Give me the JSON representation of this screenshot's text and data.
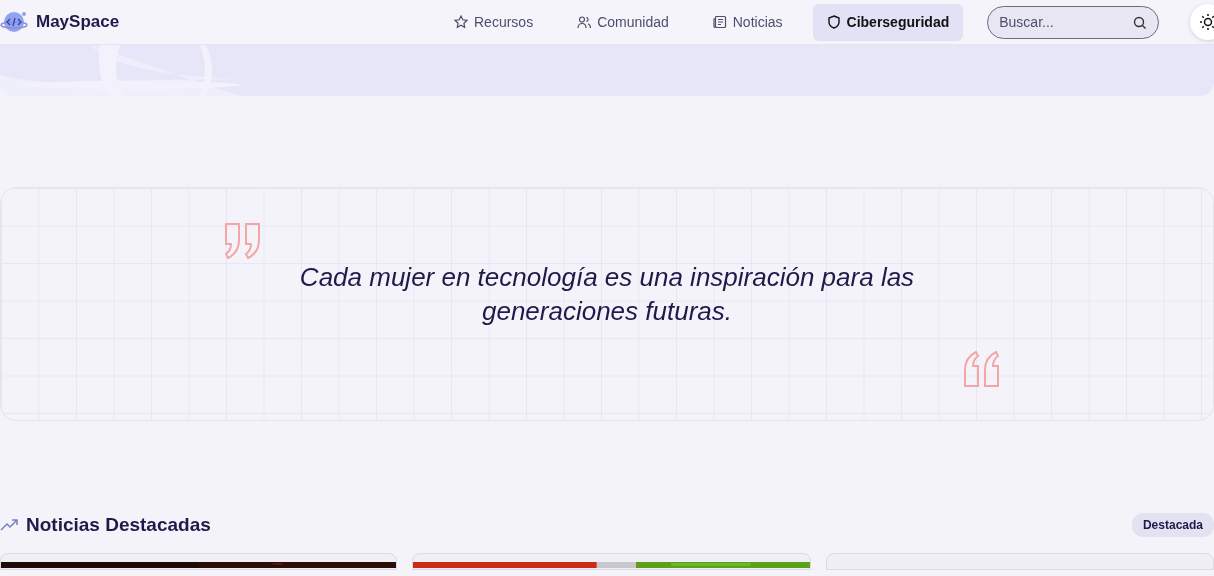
{
  "brand": {
    "name": "MaySpace"
  },
  "nav": [
    {
      "label": "Recursos",
      "selected": false
    },
    {
      "label": "Comunidad",
      "selected": false
    },
    {
      "label": "Noticias",
      "selected": false
    },
    {
      "label": "Ciberseguridad",
      "selected": true
    }
  ],
  "search": {
    "placeholder": "Buscar..."
  },
  "quote": {
    "text": "Cada mujer en tecnología es una inspiración para las generaciones futuras."
  },
  "news": {
    "title": "Noticias Destacadas",
    "badge": "Destacada",
    "cards": [
      {
        "kind": "picture"
      },
      {
        "kind": "picture"
      },
      {
        "kind": "blank"
      }
    ]
  }
}
